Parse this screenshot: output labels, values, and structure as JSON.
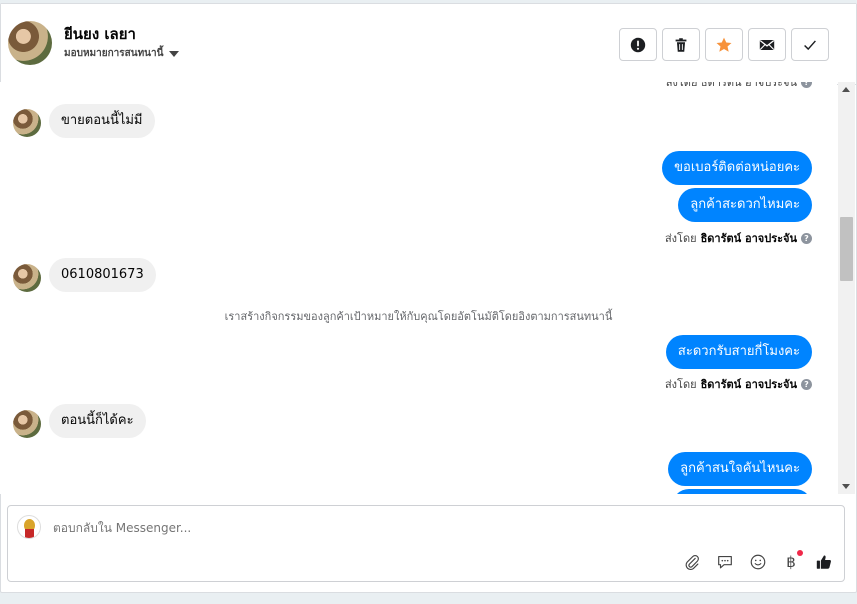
{
  "header": {
    "contact_name": "ยีนยง เลยา",
    "assign_label": "มอบหมายการสนทนานี้",
    "actions": [
      {
        "id": "spam",
        "icon": "exclamation-circle-icon",
        "color": "#1c1e21"
      },
      {
        "id": "delete",
        "icon": "trash-icon",
        "color": "#1c1e21"
      },
      {
        "id": "star",
        "icon": "star-icon",
        "color": "#f7923b"
      },
      {
        "id": "email",
        "icon": "envelope-icon",
        "color": "#1c1e21"
      },
      {
        "id": "done",
        "icon": "checkmark-icon",
        "color": "#1c1e21"
      }
    ]
  },
  "chat": {
    "partial_sentby": "ส่งโดย ธิดารัตน์ อาจประจัน",
    "messages": [
      {
        "dir": "in",
        "text": "ขายตอนนี้ไม่มี"
      },
      {
        "dir": "out",
        "text": "ขอเบอร์ติดต่อหน่อยคะ"
      },
      {
        "dir": "out",
        "text": "ลูกค้าสะดวกไหมคะ"
      },
      {
        "dir": "in",
        "text": "0610801673"
      },
      {
        "dir": "out",
        "text": "สะดวกรับสายกี่โมงคะ"
      },
      {
        "dir": "in",
        "text": "ตอนนี้ก็ได้คะ"
      },
      {
        "dir": "out",
        "text": "ลูกค้าสนใจคันไหนคะ"
      }
    ],
    "sentby_prefix": "ส่งโดย",
    "sentby_name": "ธิดารัตน์ อาจประจัน",
    "system_message": "เราสร้างกิจกรรมของลูกค้าเป้าหมายให้กับคุณโดยอัตโนมัติโดยอิงตามการสนทนานี้"
  },
  "composer": {
    "placeholder": "ตอบกลับใน Messenger..."
  },
  "colors": {
    "outgoing_bubble": "#0084ff",
    "incoming_bubble": "#f0f0f0",
    "star": "#f7923b"
  }
}
